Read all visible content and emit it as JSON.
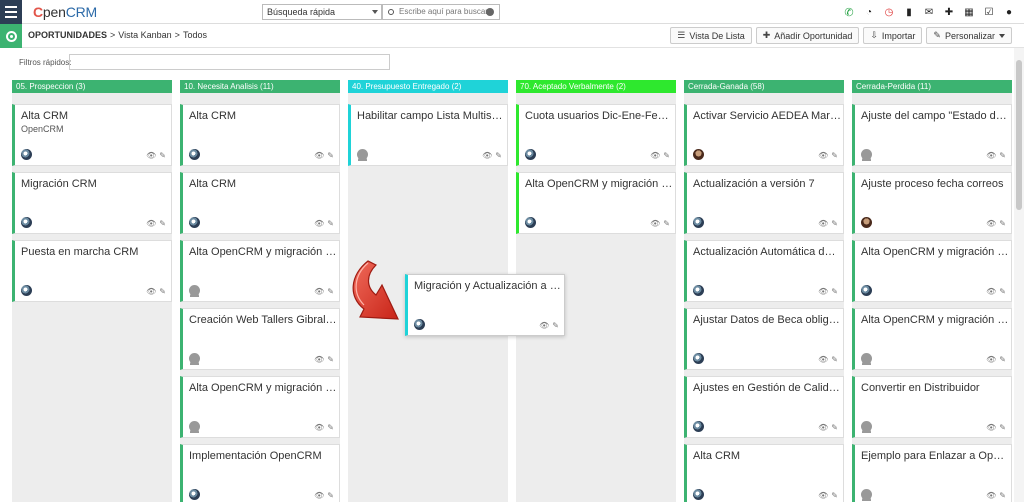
{
  "app": {
    "logo_c": "C",
    "logo_pen": "pen",
    "logo_crm": "CRM"
  },
  "search": {
    "scope": "Búsqueda rápida",
    "placeholder": "Escribe aquí para buscar"
  },
  "top_icons": [
    "whatsapp-icon",
    "dashboard-icon",
    "clock-icon",
    "lock-icon",
    "mail-icon",
    "plus-icon",
    "calendar-icon",
    "tasks-icon",
    "user-icon"
  ],
  "breadcrumb": {
    "module": "OPORTUNIDADES",
    "sep1": ">",
    "view": "Vista Kanban",
    "sep2": ">",
    "filter": "Todos"
  },
  "actions": {
    "list_view": "Vista De Lista",
    "add": "Añadir Oportunidad",
    "import": "Importar",
    "customize": "Personalizar"
  },
  "quick_filter": {
    "label": "Filtros rápidos:",
    "value": ""
  },
  "colors": {
    "green": "#3cb371",
    "cyan": "#1fd3d8",
    "lime": "#2ee82e",
    "arrow_red": "#d9342b"
  },
  "columns": [
    {
      "title": "05. Prospeccion (3)",
      "cards": [
        {
          "title": "Alta CRM",
          "sub": "OpenCRM",
          "avatar": "logo"
        },
        {
          "title": "Migración CRM",
          "sub": "",
          "avatar": "logo"
        },
        {
          "title": "Puesta en marcha CRM",
          "sub": "",
          "avatar": "logo"
        }
      ]
    },
    {
      "title": "10. Necesita Analisis (11)",
      "cards": [
        {
          "title": "Alta CRM",
          "sub": "",
          "avatar": "logo"
        },
        {
          "title": "Alta CRM",
          "sub": "",
          "avatar": "logo"
        },
        {
          "title": "Alta OpenCRM y migración des...",
          "sub": "",
          "avatar": "generic"
        },
        {
          "title": "Creación Web Tallers Gibraltar",
          "sub": "",
          "avatar": "generic"
        },
        {
          "title": "Alta OpenCRM y migración des...",
          "sub": "",
          "avatar": "generic"
        },
        {
          "title": "Implementación OpenCRM",
          "sub": "",
          "avatar": "logo"
        }
      ]
    },
    {
      "title": "40. Presupuesto Entregado (2)",
      "cards": [
        {
          "title": "Habilitar campo Lista Multisele...",
          "sub": "",
          "avatar": "generic"
        }
      ]
    },
    {
      "title": "70. Aceptado Verbalmente (2)",
      "cards": [
        {
          "title": "Cuota usuarios Dic-Ene-Feb y ...",
          "sub": "",
          "avatar": "logo"
        },
        {
          "title": "Alta OpenCRM y migración des...",
          "sub": "",
          "avatar": "logo"
        }
      ]
    },
    {
      "title": "Cerrada-Ganada (58)",
      "cards": [
        {
          "title": "Activar Servicio AEDEA Marca ...",
          "sub": "",
          "avatar": "photo"
        },
        {
          "title": "Actualización a versión 7",
          "sub": "",
          "avatar": "logo"
        },
        {
          "title": "Actualización Automática de A...",
          "sub": "",
          "avatar": "logo"
        },
        {
          "title": "Ajustar Datos de Beca obligato...",
          "sub": "",
          "avatar": "logo"
        },
        {
          "title": "Ajustes en Gestión de Calidad ...",
          "sub": "",
          "avatar": "logo"
        },
        {
          "title": "Alta CRM",
          "sub": "",
          "avatar": "logo"
        }
      ]
    },
    {
      "title": "Cerrada-Perdida (11)",
      "cards": [
        {
          "title": "Ajuste del campo \"Estado de M...",
          "sub": "",
          "avatar": "generic"
        },
        {
          "title": "Ajuste proceso fecha correos",
          "sub": "",
          "avatar": "photo"
        },
        {
          "title": "Alta OpenCRM y migración des...",
          "sub": "",
          "avatar": "logo"
        },
        {
          "title": "Alta OpenCRM y migración des...",
          "sub": "",
          "avatar": "generic"
        },
        {
          "title": "Convertir en Distribuidor",
          "sub": "",
          "avatar": "generic"
        },
        {
          "title": "Ejemplo para Enlazar a Oportu...",
          "sub": "",
          "avatar": "generic"
        }
      ]
    }
  ],
  "dragged_card": {
    "title": "Migración y Actualización a la v...",
    "avatar": "logo"
  },
  "card_tools": {
    "view": "👁",
    "edit": "✎"
  }
}
